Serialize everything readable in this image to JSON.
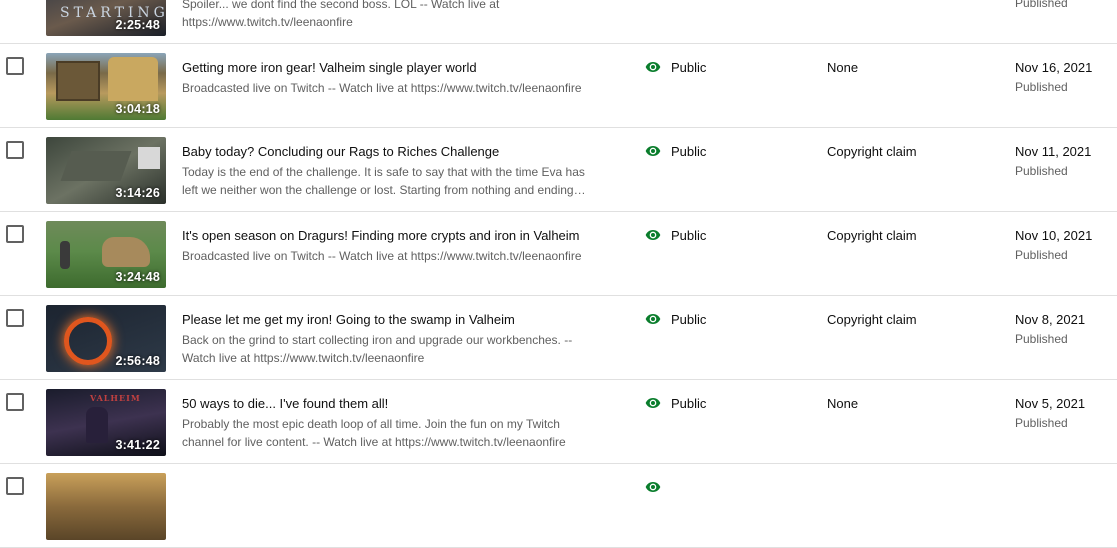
{
  "rows": [
    {
      "title": "",
      "description": "Spoiler... we dont find the second boss. LOL -- Watch live at https://www.twitch.tv/leenaonfire",
      "duration": "2:25:48",
      "thumbnail_text": "STARTING",
      "visibility": "",
      "restrictions": "",
      "date": "",
      "status": "Published",
      "thumbnail_colors": [
        "#2b3443",
        "#6a5a4c",
        "#1a1f28"
      ]
    },
    {
      "title": "Getting more iron gear! Valheim single player world",
      "description": "Broadcasted live on Twitch -- Watch live at https://www.twitch.tv/leenaonfire",
      "duration": "3:04:18",
      "visibility": "Public",
      "restrictions": "None",
      "date": "Nov 16, 2021",
      "status": "Published",
      "thumbnail_colors": [
        "#7a6a48",
        "#b89a5e",
        "#4f7a34"
      ]
    },
    {
      "title": "Baby today? Concluding our Rags to Riches Challenge",
      "description": "Today is the end of the challenge. It is safe to say that with the time Eva has left we neither won the challenge or lost. Starting from nothing and ending…",
      "duration": "3:14:26",
      "visibility": "Public",
      "restrictions": "Copyright claim",
      "date": "Nov 11, 2021",
      "status": "Published",
      "thumbnail_colors": [
        "#3d463c",
        "#6c7263",
        "#2a302a"
      ]
    },
    {
      "title": "It's open season on Dragurs! Finding more crypts and iron in Valheim",
      "description": "Broadcasted live on Twitch -- Watch live at https://www.twitch.tv/leenaonfire",
      "duration": "3:24:48",
      "visibility": "Public",
      "restrictions": "Copyright claim",
      "date": "Nov 10, 2021",
      "status": "Published",
      "thumbnail_colors": [
        "#5c8a4a",
        "#a78a5c",
        "#3d6b2e"
      ]
    },
    {
      "title": "Please let me get my iron! Going to the swamp in Valheim",
      "description": "Back on the grind to start collecting iron and upgrade our workbenches. -- Watch live at https://www.twitch.tv/leenaonfire",
      "duration": "2:56:48",
      "visibility": "Public",
      "restrictions": "Copyright claim",
      "date": "Nov 8, 2021",
      "status": "Published",
      "thumbnail_colors": [
        "#1c2430",
        "#e0561e",
        "#2e3a48"
      ]
    },
    {
      "title": "50 ways to die... I've found them all!",
      "description": "Probably the most epic death loop of all time. Join the fun on my Twitch channel for live content. -- Watch live at https://www.twitch.tv/leenaonfire",
      "duration": "3:41:22",
      "thumbnail_text": "VALHEIM",
      "visibility": "Public",
      "restrictions": "None",
      "date": "Nov 5, 2021",
      "status": "Published",
      "thumbnail_colors": [
        "#1a1c2c",
        "#3d3250",
        "#0e0f18"
      ]
    },
    {
      "title": "",
      "description": "",
      "duration": "",
      "visibility": "",
      "restrictions": "",
      "date": "",
      "status": "",
      "thumbnail_colors": [
        "#8a6a3c",
        "#c9a05a",
        "#5a4528"
      ]
    }
  ],
  "colors": {
    "eye": "#0a7d2c",
    "divider": "#e0e0e0",
    "secondary_text": "#606060"
  }
}
